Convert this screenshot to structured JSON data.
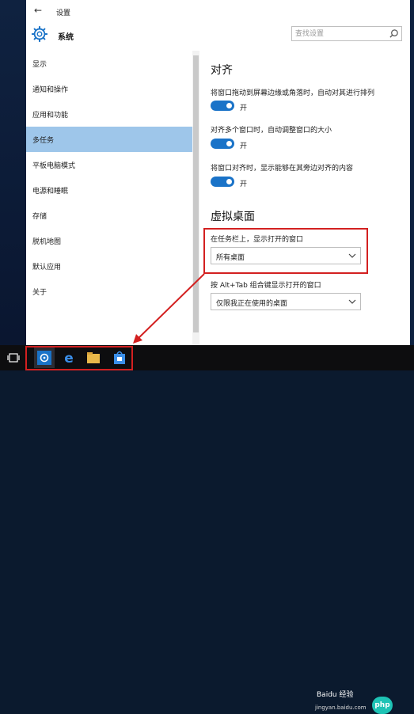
{
  "window": {
    "title": "设置",
    "section": "系统"
  },
  "search": {
    "placeholder": "查找设置"
  },
  "sidebar": {
    "items": [
      {
        "label": "显示"
      },
      {
        "label": "通知和操作"
      },
      {
        "label": "应用和功能"
      },
      {
        "label": "多任务",
        "active": true
      },
      {
        "label": "平板电脑模式"
      },
      {
        "label": "电源和睡眠"
      },
      {
        "label": "存储"
      },
      {
        "label": "脱机地图"
      },
      {
        "label": "默认应用"
      },
      {
        "label": "关于"
      }
    ]
  },
  "snap": {
    "heading": "对齐",
    "options": [
      {
        "label": "将窗口拖动到屏幕边缘或角落时，自动对其进行排列",
        "state": "开"
      },
      {
        "label": "对齐多个窗口时，自动调整窗口的大小",
        "state": "开"
      },
      {
        "label": "将窗口对齐时，显示能够在其旁边对齐的内容",
        "state": "开"
      }
    ]
  },
  "virtual_desktops": {
    "heading": "虚拟桌面",
    "taskbar_label": "在任务栏上，显示打开的窗口",
    "taskbar_value": "所有桌面",
    "alttab_label": "按 Alt+Tab 组合键显示打开的窗口",
    "alttab_value": "仅限我正在使用的桌面"
  },
  "watermark": {
    "brand": "Baidu 经验",
    "site": "jingyan.baidu.com",
    "badge": "php"
  },
  "colors": {
    "accent": "#1a73c8",
    "active_nav": "#9ec6ea",
    "highlight": "#d32020",
    "taskbar": "#0d0d0f"
  },
  "icons": [
    "back-arrow-icon",
    "gear-icon",
    "search-icon",
    "chevron-down-icon",
    "task-view-icon",
    "settings-app-icon",
    "edge-icon",
    "file-explorer-icon",
    "store-icon"
  ]
}
